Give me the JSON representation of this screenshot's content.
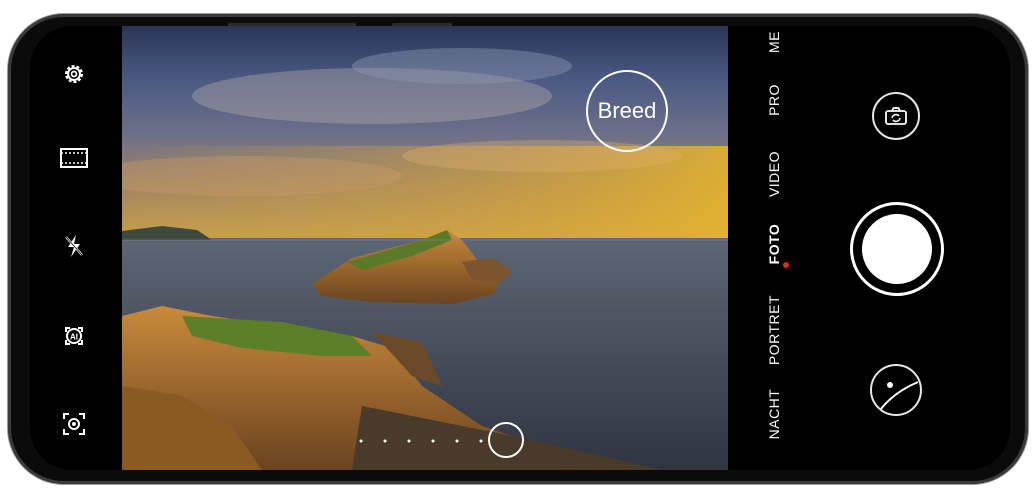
{
  "toolbar": {
    "icons": [
      "settings-icon",
      "video-format-icon",
      "flash-off-icon",
      "ai-icon",
      "focus-mode-icon"
    ]
  },
  "viewfinder": {
    "aperture_label": "Breed"
  },
  "modes": {
    "items": [
      {
        "label": "NACHT"
      },
      {
        "label": "PORTRET"
      },
      {
        "label": "FOTO"
      },
      {
        "label": "VIDEO"
      },
      {
        "label": "PRO"
      },
      {
        "label": "ME"
      }
    ],
    "active": "FOTO"
  },
  "controls": {
    "switch_camera_icon": "camera-switch-icon",
    "shutter_icon": "shutter-button",
    "gallery_icon": "gallery-thumbnail"
  },
  "colors": {
    "active_indicator": "#e0291b",
    "background": "#000000"
  }
}
